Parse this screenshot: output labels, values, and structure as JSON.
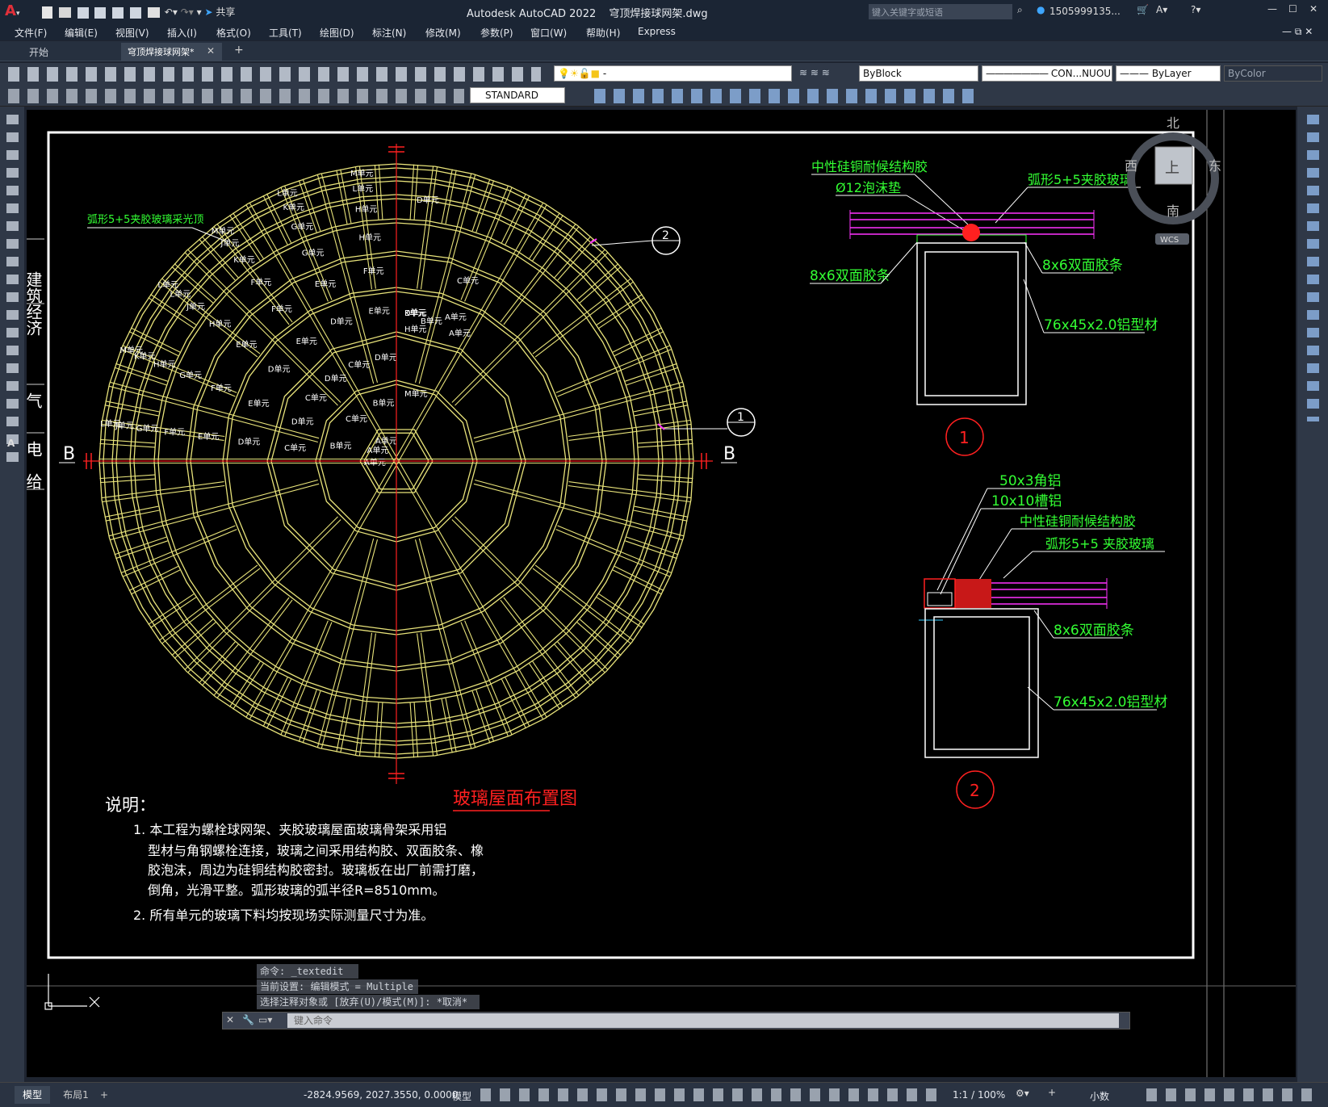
{
  "app": {
    "title": "Autodesk AutoCAD 2022",
    "filename": "穹顶焊接球网架.dwg",
    "search_placeholder": "键入关键字或短语",
    "user": "1505999135...",
    "share_label": "共享"
  },
  "menu": [
    "文件(F)",
    "编辑(E)",
    "视图(V)",
    "插入(I)",
    "格式(O)",
    "工具(T)",
    "绘图(D)",
    "标注(N)",
    "修改(M)",
    "参数(P)",
    "窗口(W)",
    "帮助(H)",
    "Express"
  ],
  "tabs": {
    "start": "开始",
    "active": "穹顶焊接球网架*"
  },
  "toolbar": {
    "layer_value": "-",
    "color": "ByBlock",
    "linetype": "CON...NUOU",
    "lineweight": "ByLayer",
    "plotstyle": "ByColor",
    "textstyle": "STANDARD"
  },
  "viewcube": {
    "north": "北",
    "south": "南",
    "east": "东",
    "west": "西",
    "top": "上",
    "wcs": "WCS"
  },
  "drawing": {
    "left_callout": "弧形5+5夹胶玻璃采光顶",
    "section_left": "B",
    "section_right": "B",
    "detail1_marker": "1",
    "detail2_marker": "2",
    "units": {
      "A": "A单元",
      "B": "B单元",
      "C": "C单元",
      "D": "D单元",
      "E": "E单元",
      "F": "F单元",
      "G": "G单元",
      "H": "H单元",
      "J": "J单元",
      "K": "K单元",
      "L": "L单元",
      "M": "M单元"
    },
    "title": "玻璃屋面布置图",
    "notes_heading": "说明：",
    "notes": [
      "1. 本工程为螺栓球网架、夹胶玻璃屋面玻璃骨架采用铝",
      "型材与角钢螺栓连接，玻璃之间采用结构胶、双面胶条、橡",
      "胶泡沫，周边为硅铜结构胶密封。玻璃板在出厂前需打磨，",
      "倒角，光滑平整。弧形玻璃的弧半径R=8510mm。",
      "2. 所有单元的玻璃下料均按现场实际测量尺寸为准。"
    ],
    "detail1": {
      "label_sealant": "中性硅铜耐候结构胶",
      "label_foam": "Ø12泡沫垫",
      "label_glass": "弧形5+5夹胶玻璃",
      "label_tape_left": "8x6双面胶条",
      "label_tape_right": "8x6双面胶条",
      "label_profile": "76x45x2.0铝型材",
      "circle": "1"
    },
    "detail2": {
      "label_angle": "50x3角铝",
      "label_channel": "10x10槽铝",
      "label_sealant": "中性硅铜耐候结构胶",
      "label_glass": "弧形5+5 夹胶玻璃",
      "label_tape": "8x6双面胶条",
      "label_profile": "76x45x2.0铝型材",
      "circle": "2"
    },
    "side_text": [
      "建筑经济",
      "气",
      "电",
      "给"
    ]
  },
  "command": {
    "history": [
      "命令: _textedit",
      "当前设置: 编辑模式 = Multiple",
      "选择注释对象或 [放弃(U)/模式(M)]: *取消*"
    ],
    "placeholder": "键入命令"
  },
  "status": {
    "tab_model": "模型",
    "tab_layout": "布局1",
    "tab_add": "+",
    "coords": "-2824.9569, 2027.3550, 0.0000",
    "model": "模型",
    "scale": "1:1 / 100%",
    "units": "小数"
  },
  "colors": {
    "frame": "#e8e37a",
    "label_green": "#33ff33",
    "red": "#ff2020",
    "magenta": "#ff33ff",
    "white": "#ffffff"
  }
}
